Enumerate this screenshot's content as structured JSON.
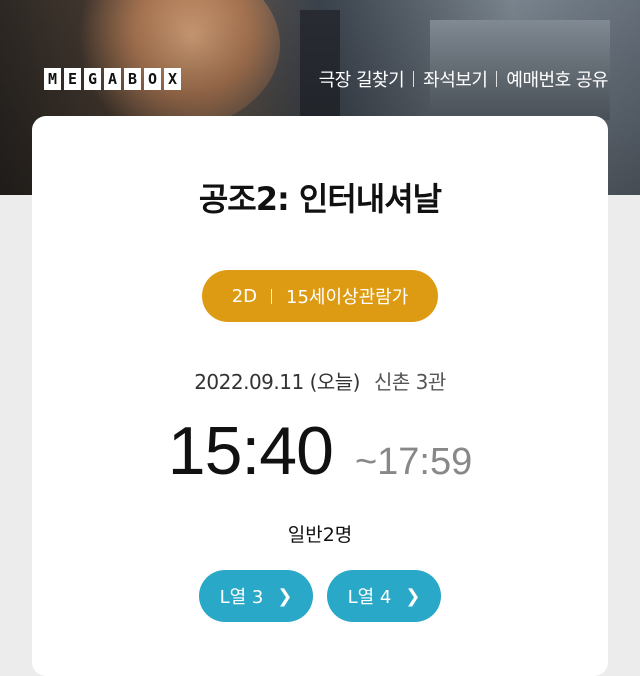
{
  "header": {
    "logo_letters": [
      "M",
      "E",
      "G",
      "A",
      "B",
      "O",
      "X"
    ],
    "nav": [
      "극장 길찾기",
      "좌석보기",
      "예매번호 공유"
    ]
  },
  "ticket": {
    "movie_title": "공조2: 인터내셔날",
    "format": "2D",
    "rating": "15세이상관람가",
    "date": "2022.09.11 (오늘)",
    "theater": "신촌 3관",
    "start_time": "15:40",
    "end_time": "~17:59",
    "people": "일반2명",
    "seats": [
      "L열 3",
      "L열 4"
    ]
  },
  "colors": {
    "rating_pill": "#dc9b12",
    "seat_button": "#29a9c7"
  },
  "icons": {
    "seat_arrow": "chevron-right-icon"
  }
}
